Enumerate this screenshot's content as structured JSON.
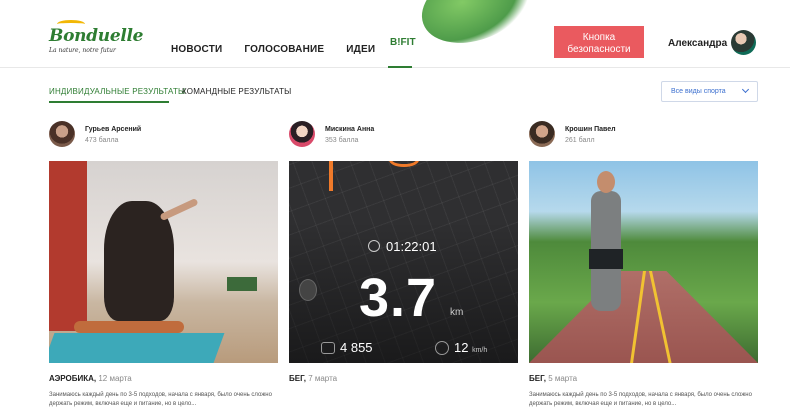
{
  "header": {
    "logo": {
      "word": "Bonduelle",
      "tagline": "La nature, notre futur"
    },
    "nav": [
      "НОВОСТИ",
      "ГОЛОСОВАНИЕ",
      "ИДЕИ"
    ],
    "nav_active": "B!FIT",
    "panic_button": "Кнопка безопасности",
    "user_name": "Александра"
  },
  "tabs": {
    "individual": "ИНДИВИДУАЛЬНЫЕ РЕЗУЛЬТАТЫ",
    "team": "КОМАНДНЫЕ РЕЗУЛЬТАТЫ",
    "filter": "Все виды спорта"
  },
  "people": [
    {
      "name": "Гурьев Арсений",
      "points": "473 балла"
    },
    {
      "name": "Мискина Анна",
      "points": "353 балла"
    },
    {
      "name": "Крошин Павел",
      "points": "261 балл"
    }
  ],
  "workout": {
    "time": "01:22:01",
    "distance": "3.7",
    "distance_unit": "km",
    "steps": "4 855",
    "speed": "12",
    "speed_unit": "km/h"
  },
  "cards": [
    {
      "category": "АЭРОБИКА,",
      "date": "12 марта",
      "text": "Занимаюсь каждый день по 3-5 подходов, начала с января, было очень сложно держать режим, включая еще и питание, но в цело..."
    },
    {
      "category": "БЕГ,",
      "date": "7 марта",
      "text": ""
    },
    {
      "category": "БЕГ,",
      "date": "5 марта",
      "text": "Занимаюсь каждый день по 3-5 подходов, начала с января, было очень сложно держать режим, включая еще и питание, но в цело..."
    }
  ]
}
